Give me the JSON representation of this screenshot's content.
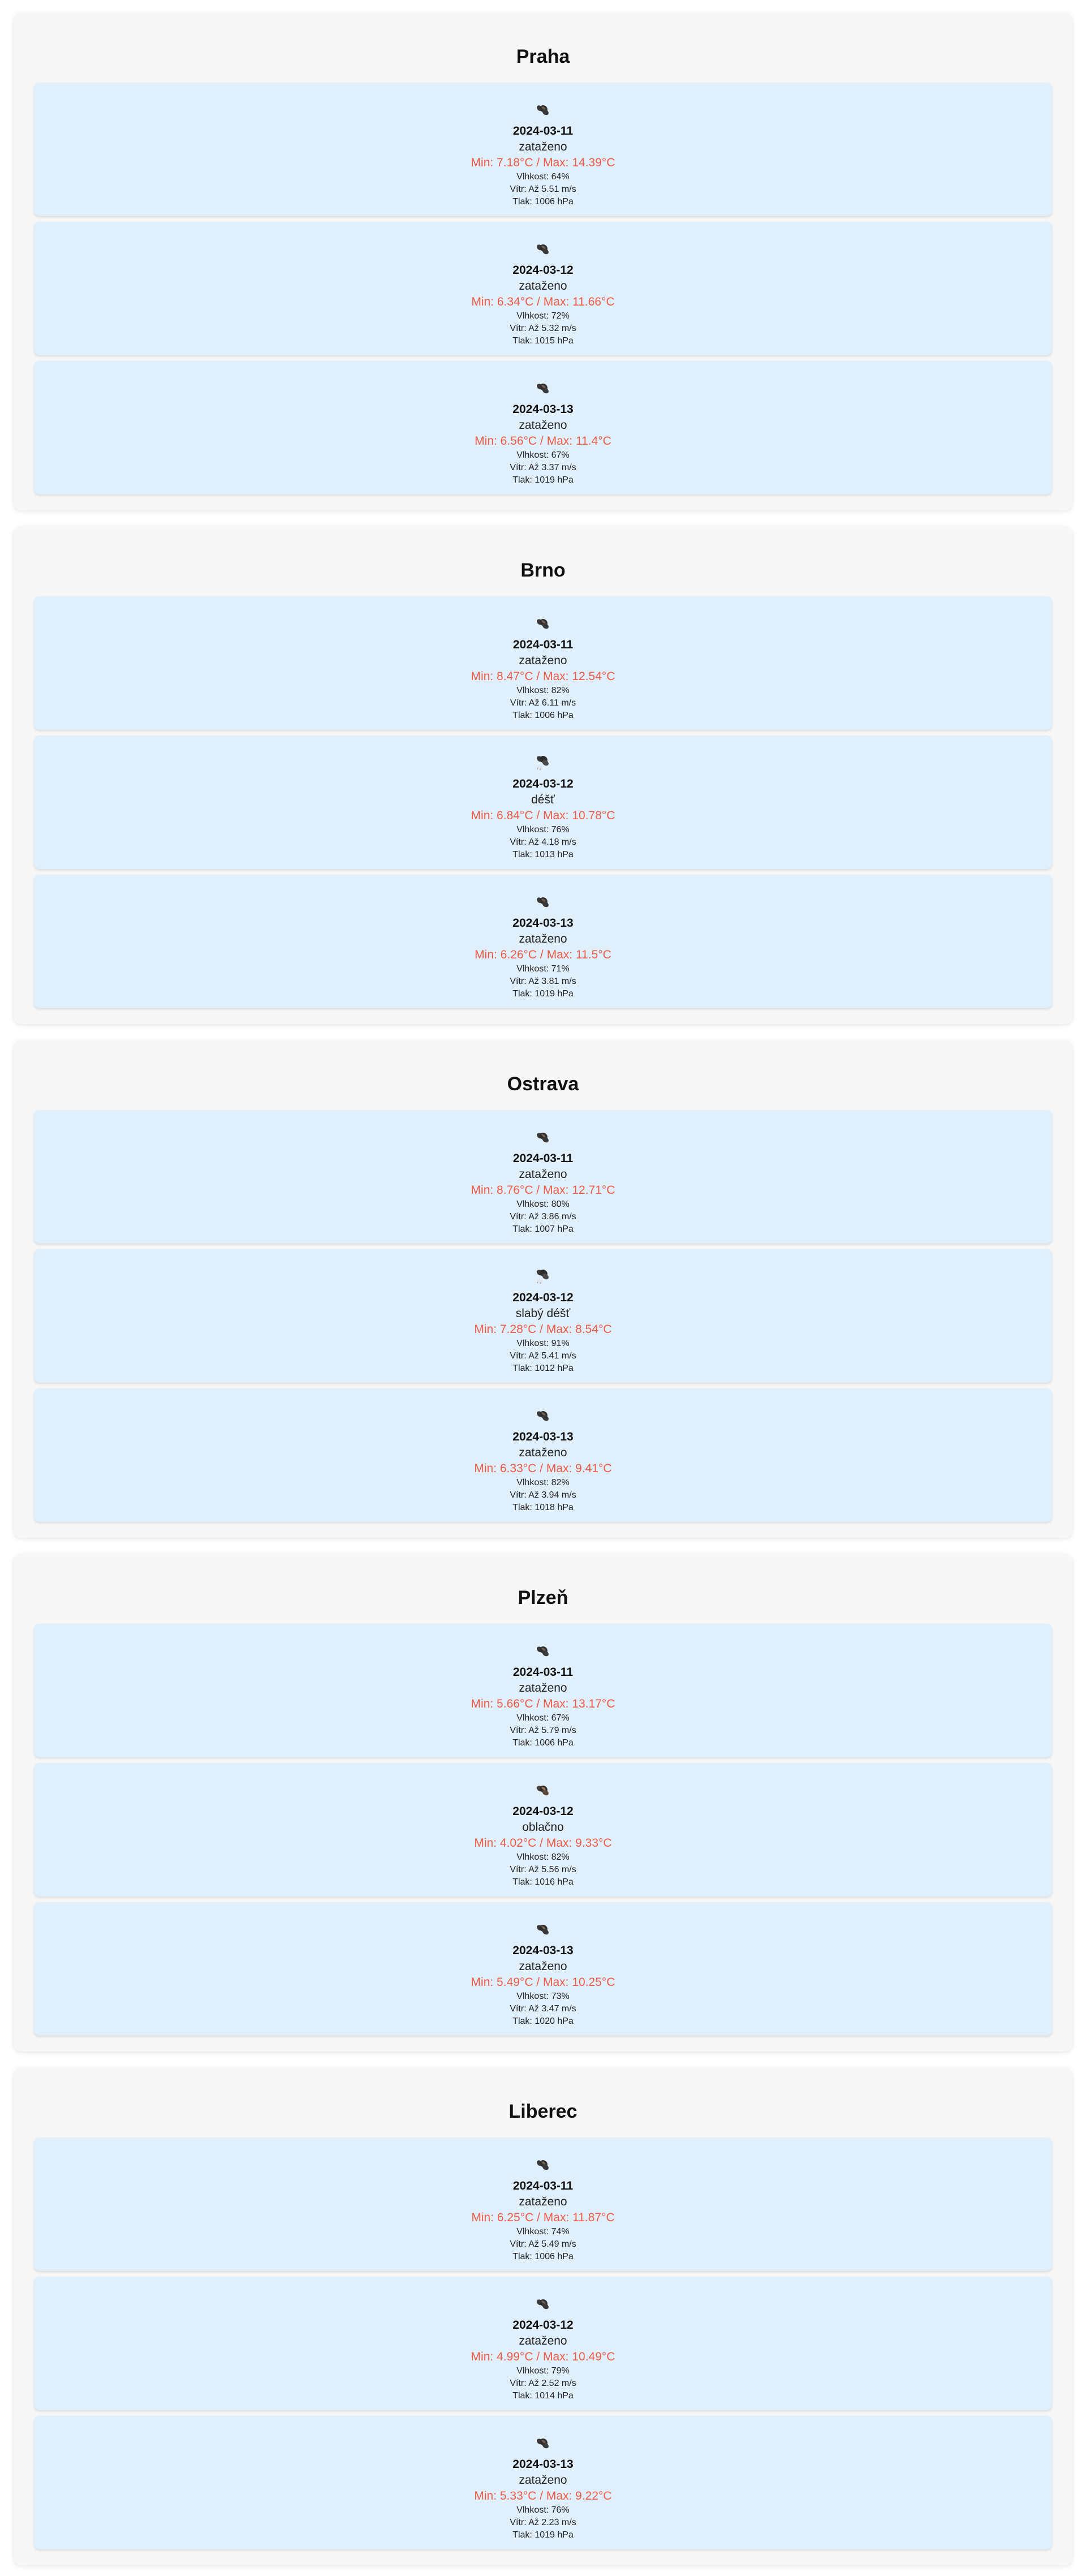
{
  "cities": [
    {
      "name": "Praha",
      "days": [
        {
          "date": "2024-03-11",
          "description": "zataženo",
          "icon": "overcast-cloud-icon",
          "temp": "Min: 7.18°C / Max: 14.39°C",
          "humidity": "Vlhkost: 64%",
          "wind": "Vítr: Až 5.51 m/s",
          "pressure": "Tlak: 1006 hPa"
        },
        {
          "date": "2024-03-12",
          "description": "zataženo",
          "icon": "overcast-cloud-icon",
          "temp": "Min: 6.34°C / Max: 11.66°C",
          "humidity": "Vlhkost: 72%",
          "wind": "Vítr: Až 5.32 m/s",
          "pressure": "Tlak: 1015 hPa"
        },
        {
          "date": "2024-03-13",
          "description": "zataženo",
          "icon": "overcast-cloud-icon",
          "temp": "Min: 6.56°C / Max: 11.4°C",
          "humidity": "Vlhkost: 67%",
          "wind": "Vítr: Až 3.37 m/s",
          "pressure": "Tlak: 1019 hPa"
        }
      ]
    },
    {
      "name": "Brno",
      "days": [
        {
          "date": "2024-03-11",
          "description": "zataženo",
          "icon": "overcast-cloud-icon",
          "temp": "Min: 8.47°C / Max: 12.54°C",
          "humidity": "Vlhkost: 82%",
          "wind": "Vítr: Až 6.11 m/s",
          "pressure": "Tlak: 1006 hPa"
        },
        {
          "date": "2024-03-12",
          "description": "déšť",
          "icon": "rain-cloud-icon",
          "temp": "Min: 6.84°C / Max: 10.78°C",
          "humidity": "Vlhkost: 76%",
          "wind": "Vítr: Až 4.18 m/s",
          "pressure": "Tlak: 1013 hPa"
        },
        {
          "date": "2024-03-13",
          "description": "zataženo",
          "icon": "overcast-cloud-icon",
          "temp": "Min: 6.26°C / Max: 11.5°C",
          "humidity": "Vlhkost: 71%",
          "wind": "Vítr: Až 3.81 m/s",
          "pressure": "Tlak: 1019 hPa"
        }
      ]
    },
    {
      "name": "Ostrava",
      "days": [
        {
          "date": "2024-03-11",
          "description": "zataženo",
          "icon": "overcast-cloud-icon",
          "temp": "Min: 8.76°C / Max: 12.71°C",
          "humidity": "Vlhkost: 80%",
          "wind": "Vítr: Až 3.86 m/s",
          "pressure": "Tlak: 1007 hPa"
        },
        {
          "date": "2024-03-12",
          "description": "slabý déšť",
          "icon": "rain-cloud-icon",
          "temp": "Min: 7.28°C / Max: 8.54°C",
          "humidity": "Vlhkost: 91%",
          "wind": "Vítr: Až 5.41 m/s",
          "pressure": "Tlak: 1012 hPa"
        },
        {
          "date": "2024-03-13",
          "description": "zataženo",
          "icon": "overcast-cloud-icon",
          "temp": "Min: 6.33°C / Max: 9.41°C",
          "humidity": "Vlhkost: 82%",
          "wind": "Vítr: Až 3.94 m/s",
          "pressure": "Tlak: 1018 hPa"
        }
      ]
    },
    {
      "name": "Plzeň",
      "days": [
        {
          "date": "2024-03-11",
          "description": "zataženo",
          "icon": "overcast-cloud-icon",
          "temp": "Min: 5.66°C / Max: 13.17°C",
          "humidity": "Vlhkost: 67%",
          "wind": "Vítr: Až 5.79 m/s",
          "pressure": "Tlak: 1006 hPa"
        },
        {
          "date": "2024-03-12",
          "description": "oblačno",
          "icon": "broken-cloud-icon",
          "temp": "Min: 4.02°C / Max: 9.33°C",
          "humidity": "Vlhkost: 82%",
          "wind": "Vítr: Až 5.56 m/s",
          "pressure": "Tlak: 1016 hPa"
        },
        {
          "date": "2024-03-13",
          "description": "zataženo",
          "icon": "overcast-cloud-icon",
          "temp": "Min: 5.49°C / Max: 10.25°C",
          "humidity": "Vlhkost: 73%",
          "wind": "Vítr: Až 3.47 m/s",
          "pressure": "Tlak: 1020 hPa"
        }
      ]
    },
    {
      "name": "Liberec",
      "days": [
        {
          "date": "2024-03-11",
          "description": "zataženo",
          "icon": "overcast-cloud-icon",
          "temp": "Min: 6.25°C / Max: 11.87°C",
          "humidity": "Vlhkost: 74%",
          "wind": "Vítr: Až 5.49 m/s",
          "pressure": "Tlak: 1006 hPa"
        },
        {
          "date": "2024-03-12",
          "description": "zataženo",
          "icon": "overcast-cloud-icon",
          "temp": "Min: 4.99°C / Max: 10.49°C",
          "humidity": "Vlhkost: 79%",
          "wind": "Vítr: Až 2.52 m/s",
          "pressure": "Tlak: 1014 hPa"
        },
        {
          "date": "2024-03-13",
          "description": "zataženo",
          "icon": "overcast-cloud-icon",
          "temp": "Min: 5.33°C / Max: 9.22°C",
          "humidity": "Vlhkost: 76%",
          "wind": "Vítr: Až 2.23 m/s",
          "pressure": "Tlak: 1019 hPa"
        }
      ]
    }
  ],
  "colors": {
    "temperature": "#ef5a44",
    "day_card_background": "#dfeffc",
    "city_card_background": "#f7f7f7"
  }
}
